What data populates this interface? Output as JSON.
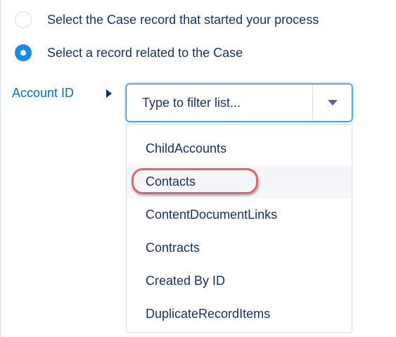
{
  "record_options": [
    {
      "label": "Select the Case record that started your process",
      "selected": false
    },
    {
      "label": "Select a record related to the Case",
      "selected": true
    }
  ],
  "field": {
    "label": "Account ID",
    "expand_icon": "triangle-right-icon"
  },
  "combobox": {
    "placeholder": "Type to filter list...",
    "dropdown_icon": "chevron-down-icon"
  },
  "listbox": {
    "options": [
      "ChildAccounts",
      "Contacts",
      "ContentDocumentLinks",
      "Contracts",
      "Created By ID",
      "DuplicateRecordItems"
    ],
    "highlighted": "Contacts"
  },
  "colors": {
    "accent": "#1589ee",
    "link": "#0070d2",
    "text": "#16325c",
    "annotation_ring": "#e06666"
  }
}
